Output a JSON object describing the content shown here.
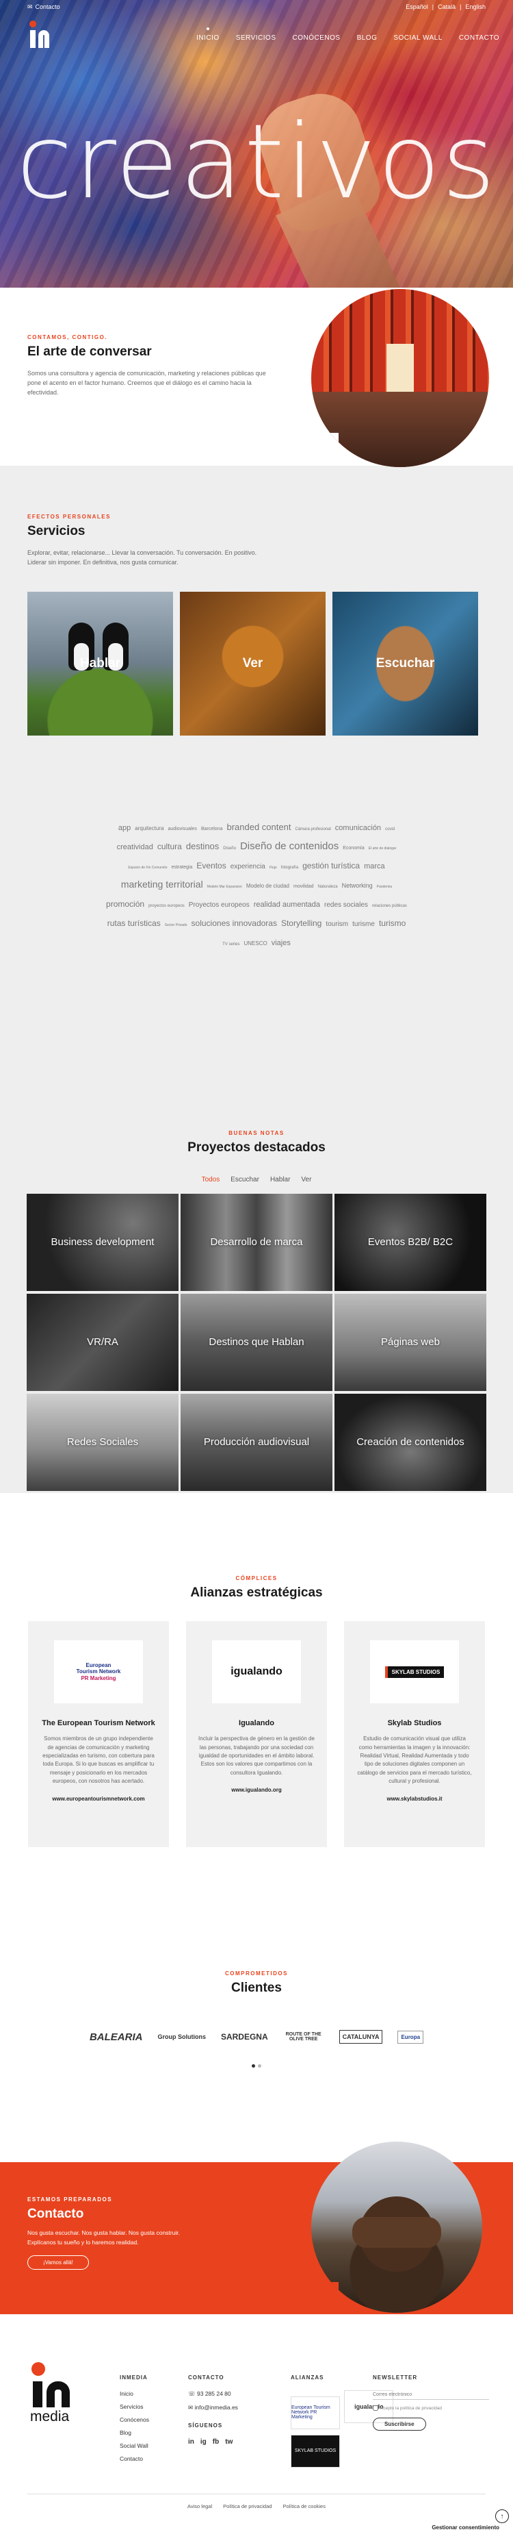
{
  "topbar": {
    "contact_label": "Contacto",
    "languages": [
      "Español",
      "Català",
      "English"
    ],
    "separators": [
      "|",
      "|"
    ]
  },
  "brand": {
    "name": "inmedia",
    "footer_wordmark": "media"
  },
  "nav": {
    "items": [
      "Inicio",
      "Servicios",
      "Conócenos",
      "Blog",
      "Social Wall",
      "Contacto"
    ]
  },
  "hero": {
    "title": "creativos"
  },
  "intro": {
    "kicker": "Contamos, contigo.",
    "title": "El arte de conversar",
    "text": "Somos una consultora y agencia de comunicación, marketing y relaciones públicas que pone el acento en el factor humano. Creemos que el diálogo es el camino hacia la efectividad."
  },
  "servicios": {
    "kicker": "Efectos personales",
    "title": "Servicios",
    "text": "Explorar, evitar, relacionarse... Llevar la conversación. Tu conversación. En positivo. Liderar sin imponer. En definitiva, nos gusta comunicar.",
    "cards": [
      "Hablar",
      "Ver",
      "Escuchar"
    ]
  },
  "tags": [
    {
      "t": "app",
      "s": 11
    },
    {
      "t": "arquitectura",
      "s": 8
    },
    {
      "t": "audiovisuales",
      "s": 7
    },
    {
      "t": "Barcelona",
      "s": 7
    },
    {
      "t": "branded content",
      "s": 13
    },
    {
      "t": "Cámara profesional",
      "s": 6
    },
    {
      "t": "comunicación",
      "s": 11
    },
    {
      "t": "covid",
      "s": 6
    },
    {
      "t": "creatividad",
      "s": 11
    },
    {
      "t": "cultura",
      "s": 12
    },
    {
      "t": "destinos",
      "s": 13
    },
    {
      "t": "Diseño",
      "s": 6
    },
    {
      "t": "Diseño de contenidos",
      "s": 15
    },
    {
      "t": "Economía",
      "s": 7
    },
    {
      "t": "El arte de dialogar",
      "s": 5
    },
    {
      "t": "Espacio de Fin Comunión",
      "s": 5
    },
    {
      "t": "estrategia",
      "s": 7
    },
    {
      "t": "Eventos",
      "s": 12
    },
    {
      "t": "experiencia",
      "s": 10
    },
    {
      "t": "Flujo",
      "s": 5
    },
    {
      "t": "fotografía",
      "s": 6
    },
    {
      "t": "gestión turística",
      "s": 12
    },
    {
      "t": "marca",
      "s": 11
    },
    {
      "t": "marketing territorial",
      "s": 14
    },
    {
      "t": "Modelo Mar Expansion",
      "s": 5
    },
    {
      "t": "Modelo de ciudad",
      "s": 8
    },
    {
      "t": "movilidad",
      "s": 7
    },
    {
      "t": "Naturaleza",
      "s": 6
    },
    {
      "t": "Networking",
      "s": 9
    },
    {
      "t": "Pandemia",
      "s": 5
    },
    {
      "t": "promoción",
      "s": 12
    },
    {
      "t": "proyectos europeos",
      "s": 6
    },
    {
      "t": "Proyectos europeos",
      "s": 10
    },
    {
      "t": "realidad aumentada",
      "s": 11
    },
    {
      "t": "redes sociales",
      "s": 10
    },
    {
      "t": "relaciones públicas",
      "s": 6
    },
    {
      "t": "rutas turísticas",
      "s": 12
    },
    {
      "t": "Sector Privado",
      "s": 5
    },
    {
      "t": "soluciones innovadoras",
      "s": 12
    },
    {
      "t": "Storytelling",
      "s": 12
    },
    {
      "t": "tourism",
      "s": 10
    },
    {
      "t": "turisme",
      "s": 10
    },
    {
      "t": "turismo",
      "s": 12
    },
    {
      "t": "TV series",
      "s": 6
    },
    {
      "t": "UNESCO",
      "s": 8
    },
    {
      "t": "viajes",
      "s": 11
    }
  ],
  "proyectos": {
    "kicker": "Buenas notas",
    "title": "Proyectos destacados",
    "filters": [
      "Todos",
      "Escuchar",
      "Hablar",
      "Ver"
    ],
    "active_filter": "Todos",
    "tiles": [
      "Business development",
      "Desarrollo de marca",
      "Eventos B2B/ B2C",
      "VR/RA",
      "Destinos que Hablan",
      "Páginas web",
      "Redes Sociales",
      "Producción audiovisual",
      "Creación de contenidos"
    ]
  },
  "alianzas": {
    "kicker": "Cómplices",
    "title": "Alianzas estratégicas",
    "cards": [
      {
        "logo_lines": [
          "European",
          "Tourism Network",
          "PR Marketing"
        ],
        "name": "The European Tourism Network",
        "text": "Somos miembros de un grupo independiente de agencias de comunicación y marketing especializadas en turismo, con cobertura para toda Europa. Si lo que buscas es amplificar tu mensaje y posicionarlo en los mercados europeos, con nosotros has acertado.",
        "url": "www.europeantourismnetwork.com"
      },
      {
        "logo_lines": [
          "igualando"
        ],
        "name": "Igualando",
        "text": "Incluir la perspectiva de género en la gestión de las personas, trabajando por una sociedad con igualdad de oportunidades en el ámbito laboral. Estos son los valores que compartimos con la consultora Igualando.",
        "url": "www.igualando.org"
      },
      {
        "logo_lines": [
          "SKYLAB STUDIOS"
        ],
        "name": "Skylab Studios",
        "text": "Estudio de comunicación visual que utiliza como herramientas la imagen y la innovación: Realidad Virtual, Realidad Aumentada y todo tipo de soluciones digitales componen un catálogo de servicios para el mercado turístico, cultural y profesional.",
        "url": "www.skylabstudios.it"
      }
    ]
  },
  "clientes": {
    "kicker": "Comprometidos",
    "title": "Clientes",
    "logos": [
      "BALEARIA",
      "Group Solutions",
      "SARDEGNA",
      "ROUTE OF THE OLIVE TREE",
      "CATALUNYA",
      "Europa"
    ]
  },
  "contacto": {
    "kicker": "Estamos preparados",
    "title": "Contacto",
    "text": "Nos gusta escuchar. Nos gusta hablar. Nos gusta construir. Explícanos tu sueño y lo haremos realidad.",
    "button": "¡Vamos allá!"
  },
  "footer": {
    "col_inmedia": {
      "title": "Inmedia",
      "items": [
        "Inicio",
        "Servicios",
        "Conócenos",
        "Blog",
        "Social Wall",
        "Contacto"
      ]
    },
    "col_contacto": {
      "title": "Contacto",
      "phone": "93 285 24 80",
      "email": "info@inmedia.es",
      "follow_title": "Síguenos",
      "social": [
        "in",
        "ig",
        "fb",
        "tw"
      ]
    },
    "col_alianzas": {
      "title": "Alianzas",
      "logos": [
        "European Tourism Network PR Marketing",
        "igualando",
        "SKYLAB STUDIOS"
      ]
    },
    "col_newsletter": {
      "title": "Newsletter",
      "placeholder": "Correo electrónico",
      "check_label": "Acepto la política de privacidad",
      "button": "Suscribirse"
    },
    "legal": [
      "Aviso legal",
      "Política de privacidad",
      "Política de cookies"
    ],
    "consent": "Gestionar consentimiento"
  }
}
